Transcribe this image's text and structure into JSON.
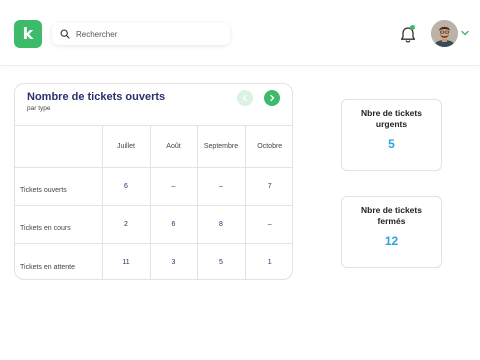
{
  "header": {
    "logo_letter": "k",
    "search": {
      "placeholder": "Rechercher"
    },
    "notification_icon": "bell-icon",
    "avatar": "user-avatar",
    "menu_icon": "chevron-down-icon"
  },
  "tickets_card": {
    "title": "Nombre de tickets ouverts",
    "subtitle": "par type",
    "columns": [
      "Juillet",
      "Août",
      "Septembre",
      "Octobre"
    ],
    "rows": [
      {
        "label": "Tickets ouverts",
        "values": [
          "6",
          "–",
          "–",
          "7"
        ]
      },
      {
        "label": "Tickets en cours",
        "values": [
          "2",
          "6",
          "8",
          "–"
        ]
      },
      {
        "label": "Tickets en attente",
        "values": [
          "11",
          "3",
          "5",
          "1"
        ]
      }
    ]
  },
  "urgent_card": {
    "label_line1": "Nbre de tickets",
    "label_line2": "urgents",
    "value": "5"
  },
  "closed_card": {
    "label_line1": "Nbre de tickets",
    "label_line2": "fermés",
    "value": "12"
  },
  "colors": {
    "brand_green": "#3dbb6a",
    "title_navy": "#2a2f6e",
    "value_blue": "#2ba4dc"
  }
}
